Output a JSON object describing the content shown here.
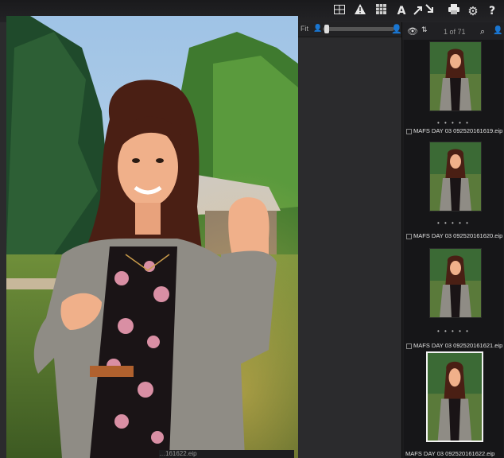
{
  "toolbar": {
    "icons": [
      "grid-view-icon",
      "warning-icon",
      "grid-icon",
      "text-icon",
      "move-icon",
      "print-icon",
      "gear-icon",
      "help-icon"
    ],
    "help_glyph": "?",
    "text_glyph": "A"
  },
  "viewer": {
    "fit_label": "Fit"
  },
  "filmstrip": {
    "counter": "1 of 71",
    "thumbnails": [
      {
        "name": "MAFS DAY 03 092520161619.eip",
        "selected": false
      },
      {
        "name": "MAFS DAY 03 092520161620.eip",
        "selected": false
      },
      {
        "name": "MAFS DAY 03 092520161621.eip",
        "selected": false
      },
      {
        "name": "MAFS DAY 03 092520161622.eip",
        "selected": true
      }
    ]
  },
  "status": {
    "bottom_filename": "…161622.eip"
  },
  "colors": {
    "accent": "#f2f2f2",
    "background": "#202022"
  }
}
